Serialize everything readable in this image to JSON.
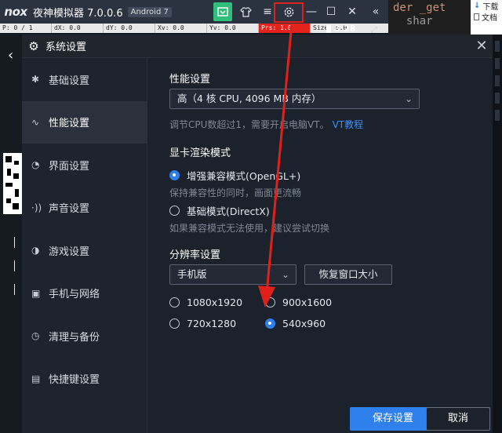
{
  "background": {
    "code_lines": [
      "der _get",
      "  shar"
    ],
    "explorer": {
      "download": "下载",
      "document": "文档"
    }
  },
  "topbar": {
    "logo": "nox",
    "title": "夜神模拟器 7.0.0.6",
    "android_badge": "Android 7",
    "icons": [
      "gift-icon",
      "shirt-icon",
      "menu-icon",
      "settings-gear-icon",
      "minimize-icon",
      "maximize-icon",
      "close-icon",
      "collapse-sidebar-icon"
    ]
  },
  "pointer_bar": {
    "cells": [
      "P: 0 / 1",
      "dX: 0.0",
      "dY: 0.0",
      "Xv: 0.0",
      "Yv: 0.0",
      "Prs: 1.0",
      "Size: 0.0"
    ],
    "time": "3:28"
  },
  "dialog": {
    "title": "系统设置",
    "sidebar": [
      {
        "label": "基础设置",
        "icon": "basic-settings-icon",
        "glyph": "✱",
        "active": false
      },
      {
        "label": "性能设置",
        "icon": "performance-icon",
        "glyph": "∿",
        "active": true
      },
      {
        "label": "界面设置",
        "icon": "palette-icon",
        "glyph": "◔",
        "active": false
      },
      {
        "label": "声音设置",
        "icon": "sound-icon",
        "glyph": "·))",
        "active": false
      },
      {
        "label": "游戏设置",
        "icon": "gamepad-icon",
        "glyph": "◑",
        "active": false
      },
      {
        "label": "手机与网络",
        "icon": "phone-network-icon",
        "glyph": "▣",
        "active": false
      },
      {
        "label": "清理与备份",
        "icon": "cleanup-icon",
        "glyph": "◷",
        "active": false
      },
      {
        "label": "快捷键设置",
        "icon": "keyboard-icon",
        "glyph": "▤",
        "active": false
      }
    ],
    "performance": {
      "title": "性能设置",
      "selected": "高（4 核 CPU, 4096 MB 内存）",
      "hint": "调节CPU数超过1，需要开启电脑VT。",
      "hint_link": "VT教程"
    },
    "render": {
      "title": "显卡渲染模式",
      "option1": "增强兼容模式(OpenGL+)",
      "option1_hint": "保持兼容性的同时，画面更流畅",
      "option2": "基础模式(DirectX)",
      "option2_hint": "如果兼容模式无法使用，建议尝试切换",
      "selected": "option1"
    },
    "resolution": {
      "title": "分辨率设置",
      "mode": "手机版",
      "restore_button": "恢复窗口大小",
      "options": [
        "1080x1920",
        "900x1600",
        "720x1280",
        "540x960"
      ],
      "selected": "540x960"
    },
    "save_button": "保存设置",
    "cancel_button": "取消"
  },
  "colors": {
    "accent": "#2f80ed",
    "annotation": "#e0201b",
    "dialog_bg": "#1c222c"
  }
}
